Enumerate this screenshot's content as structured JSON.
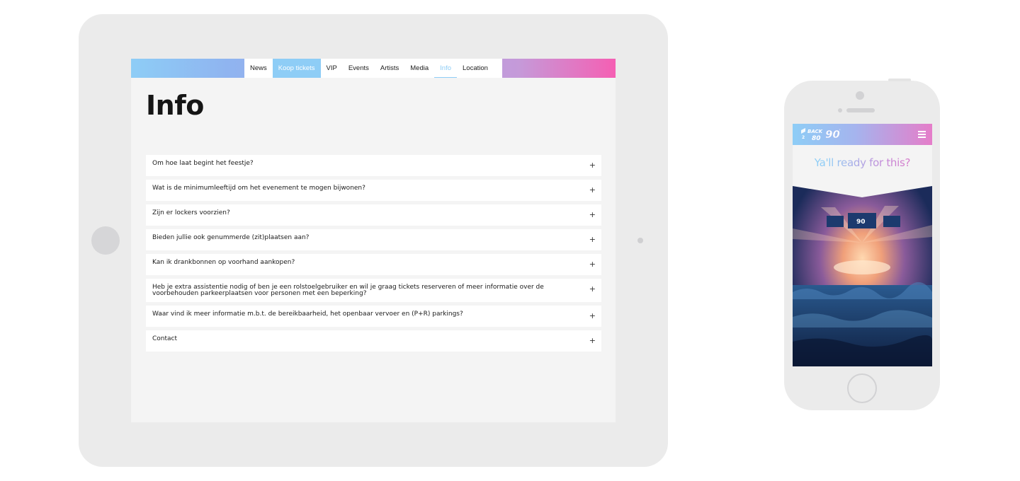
{
  "tablet": {
    "nav": {
      "items": [
        {
          "label": "News"
        },
        {
          "label": "Koop tickets"
        },
        {
          "label": "VIP"
        },
        {
          "label": "Events"
        },
        {
          "label": "Artists"
        },
        {
          "label": "Media"
        },
        {
          "label": "Info"
        },
        {
          "label": "Location"
        }
      ],
      "highlighted": "Koop tickets",
      "active": "Info"
    },
    "page_title": "Info",
    "faq": [
      {
        "question": "Om hoe laat begint het feestje?"
      },
      {
        "question": "Wat is de minimumleeftijd om het evenement te mogen bijwonen?"
      },
      {
        "question": "Zijn er lockers voorzien?"
      },
      {
        "question": "Bieden jullie ook genummerde (zit)plaatsen aan?"
      },
      {
        "question": "Kan ik drankbonnen op voorhand aankopen?"
      },
      {
        "question": "Heb je extra assistentie nodig of ben je een rolstoelgebruiker en wil je graag tickets reserveren of meer informatie over de voorbehouden parkeerplaatsen voor personen met een beperking?"
      },
      {
        "question": "Waar vind ik meer informatie m.b.t. de bereikbaarheid, het openbaar vervoer en (P+R) parkings?"
      },
      {
        "question": "Contact"
      }
    ],
    "expand_glyph": "+"
  },
  "phone": {
    "logo_text": "BACK 2 80 90",
    "tagline_parts": [
      "Ya'll ready for ",
      "this?"
    ],
    "menu_icon": "hamburger-icon"
  },
  "colors": {
    "gradient_start": "#8ecdf6",
    "gradient_end": "#f55fb3",
    "accent": "#8ecdf6"
  }
}
